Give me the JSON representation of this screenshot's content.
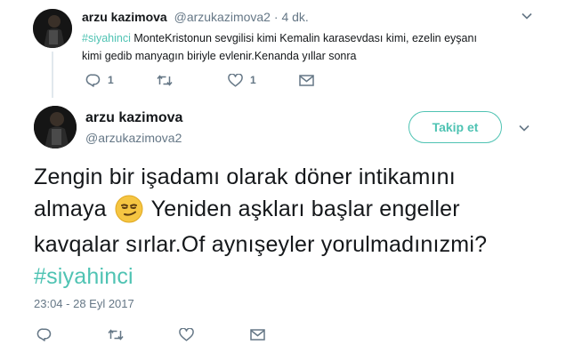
{
  "reply_tweet": {
    "author_name": "arzu kazimova",
    "author_handle": "@arzukazimova2",
    "dot": "·",
    "age": "4 dk.",
    "hashtag": "#siyahinci",
    "text_line1": " MonteKristonun sevgilisi kimi Kemalin karasevdası kimi, ezelin eyşanı",
    "text_line2": "kimi gedib manyagın biriyle evlenir.Kenanda yıllar sonra",
    "reply_count": "1",
    "retweet_count": "",
    "like_count": "1"
  },
  "main_tweet": {
    "author_name": "arzu kazimova",
    "author_handle": "@arzukazimova2",
    "follow_label": "Takip et",
    "line1": "Zengin bir işadamı olarak döner intikamını",
    "line2_before": "almaya ",
    "line2_after": " Yeniden aşkları başlar engeller",
    "line3": "kavqalar sırlar.Of aynışeyler yorulmadınızmi?",
    "hashtag": "#siyahinci",
    "timestamp": "23:04 - 28 Eyl 2017"
  },
  "icons": {
    "reply": "reply-icon",
    "retweet": "retweet-icon",
    "like": "heart-icon",
    "dm": "envelope-icon",
    "caret": "chevron-down-icon",
    "emoji": "smirking-face-emoji"
  },
  "colors": {
    "accent": "#4fc3b3",
    "muted": "#657786",
    "text": "#14171a",
    "line": "#e1e8ed"
  }
}
